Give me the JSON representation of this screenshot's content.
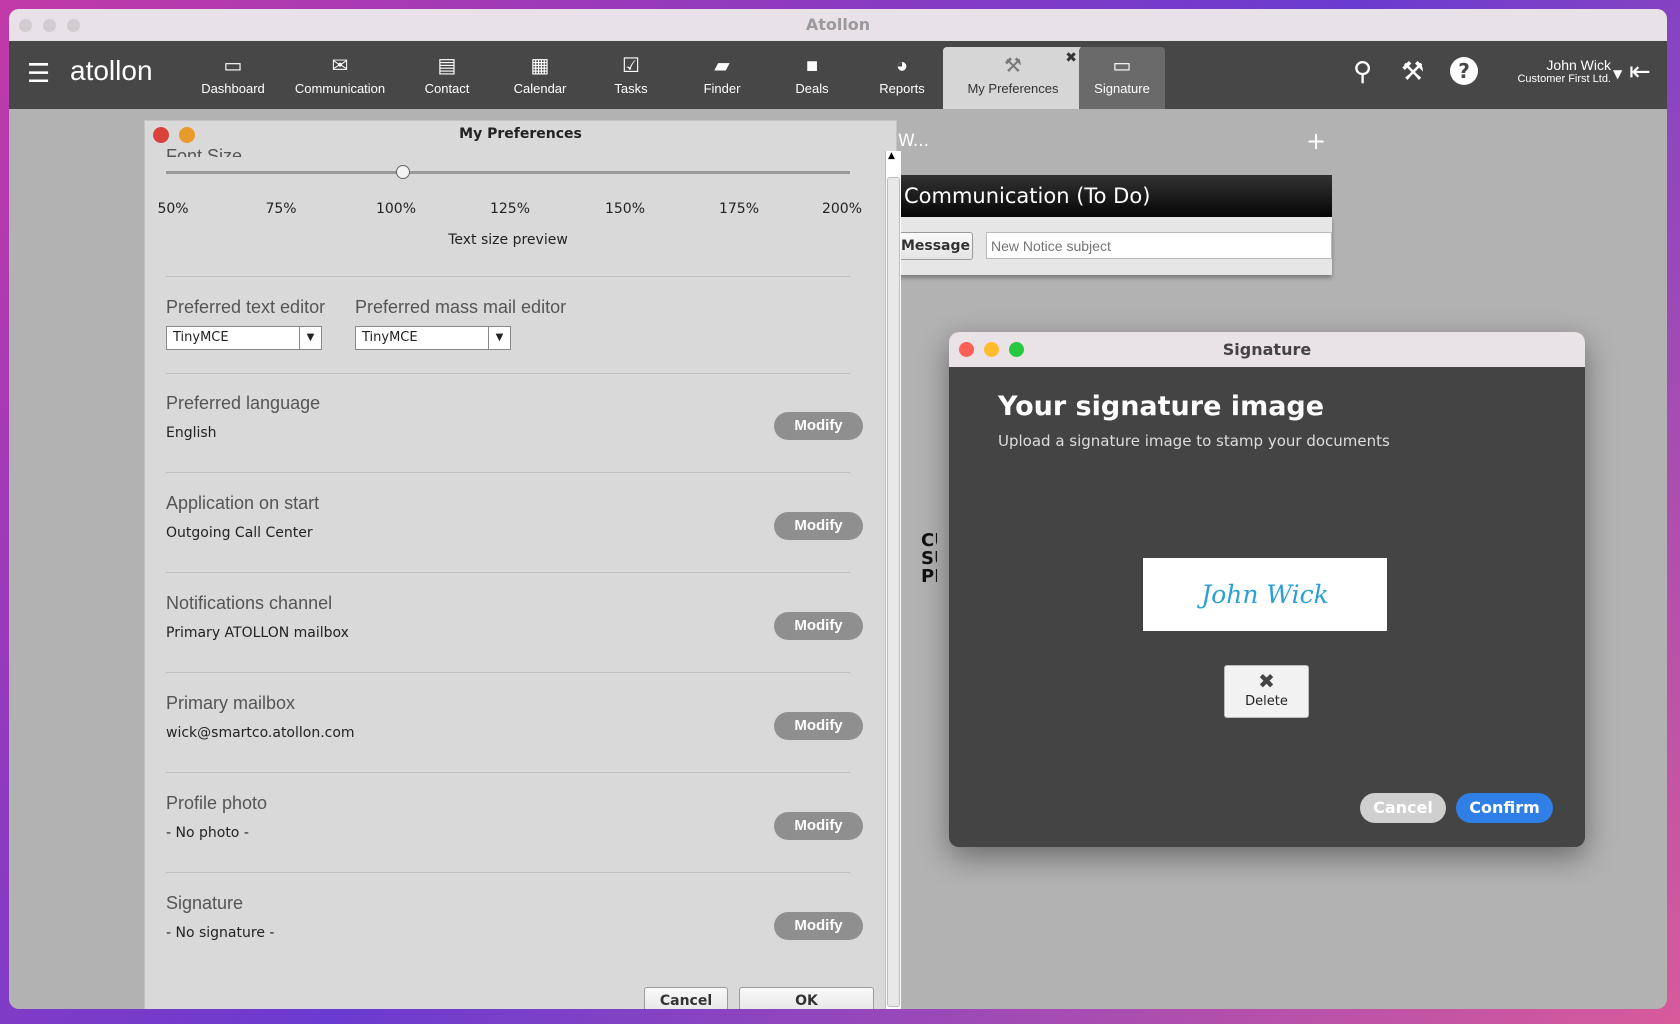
{
  "window": {
    "title": "Atollon"
  },
  "nav": {
    "logo": "atollon",
    "items": [
      {
        "label": "Dashboard",
        "icon": "dashboard-icon"
      },
      {
        "label": "Communication",
        "icon": "envelope-icon"
      },
      {
        "label": "Contact",
        "icon": "address-book-icon"
      },
      {
        "label": "Calendar",
        "icon": "calendar-icon"
      },
      {
        "label": "Tasks",
        "icon": "checkbox-icon"
      },
      {
        "label": "Finder",
        "icon": "folder-icon"
      },
      {
        "label": "Deals",
        "icon": "briefcase-icon"
      },
      {
        "label": "Reports",
        "icon": "pie-chart-icon"
      },
      {
        "label": "My Preferences",
        "icon": "wrench-icon"
      },
      {
        "label": "Signature",
        "icon": "window-icon"
      }
    ],
    "user": {
      "name": "John Wick",
      "company": "Customer First Ltd."
    }
  },
  "background": {
    "tab_title": "W...",
    "panel_title": "Communication (To Do)",
    "message_button": "Message",
    "subject_placeholder": "New Notice subject",
    "logo_text": [
      "CU",
      "SU",
      "PL"
    ]
  },
  "prefs": {
    "title": "My Preferences",
    "font_size_label": "Font Size",
    "font_size_value": "100%",
    "ticks": [
      "50%",
      "75%",
      "100%",
      "125%",
      "150%",
      "175%",
      "200%"
    ],
    "preview": "Text size preview",
    "text_editor_label": "Preferred text editor",
    "text_editor_value": "TinyMCE",
    "mass_mail_label": "Preferred mass mail editor",
    "mass_mail_value": "TinyMCE",
    "sections": [
      {
        "label": "Preferred language",
        "value": "English",
        "button": "Modify"
      },
      {
        "label": "Application on start",
        "value": "Outgoing Call Center",
        "button": "Modify"
      },
      {
        "label": "Notifications channel",
        "value": "Primary ATOLLON mailbox",
        "button": "Modify"
      },
      {
        "label": "Primary mailbox",
        "value": "wick@smartco.atollon.com",
        "button": "Modify"
      },
      {
        "label": "Profile photo",
        "value": "- No photo -",
        "button": "Modify"
      },
      {
        "label": "Signature",
        "value": "- No signature -",
        "button": "Modify"
      }
    ],
    "cancel": "Cancel",
    "ok": "OK"
  },
  "signature": {
    "title": "Signature",
    "heading": "Your signature image",
    "subtitle": "Upload a signature image to stamp your documents",
    "signature_text": "John Wick",
    "delete": "Delete",
    "cancel": "Cancel",
    "confirm": "Confirm",
    "accent": "#2f7fe6"
  }
}
